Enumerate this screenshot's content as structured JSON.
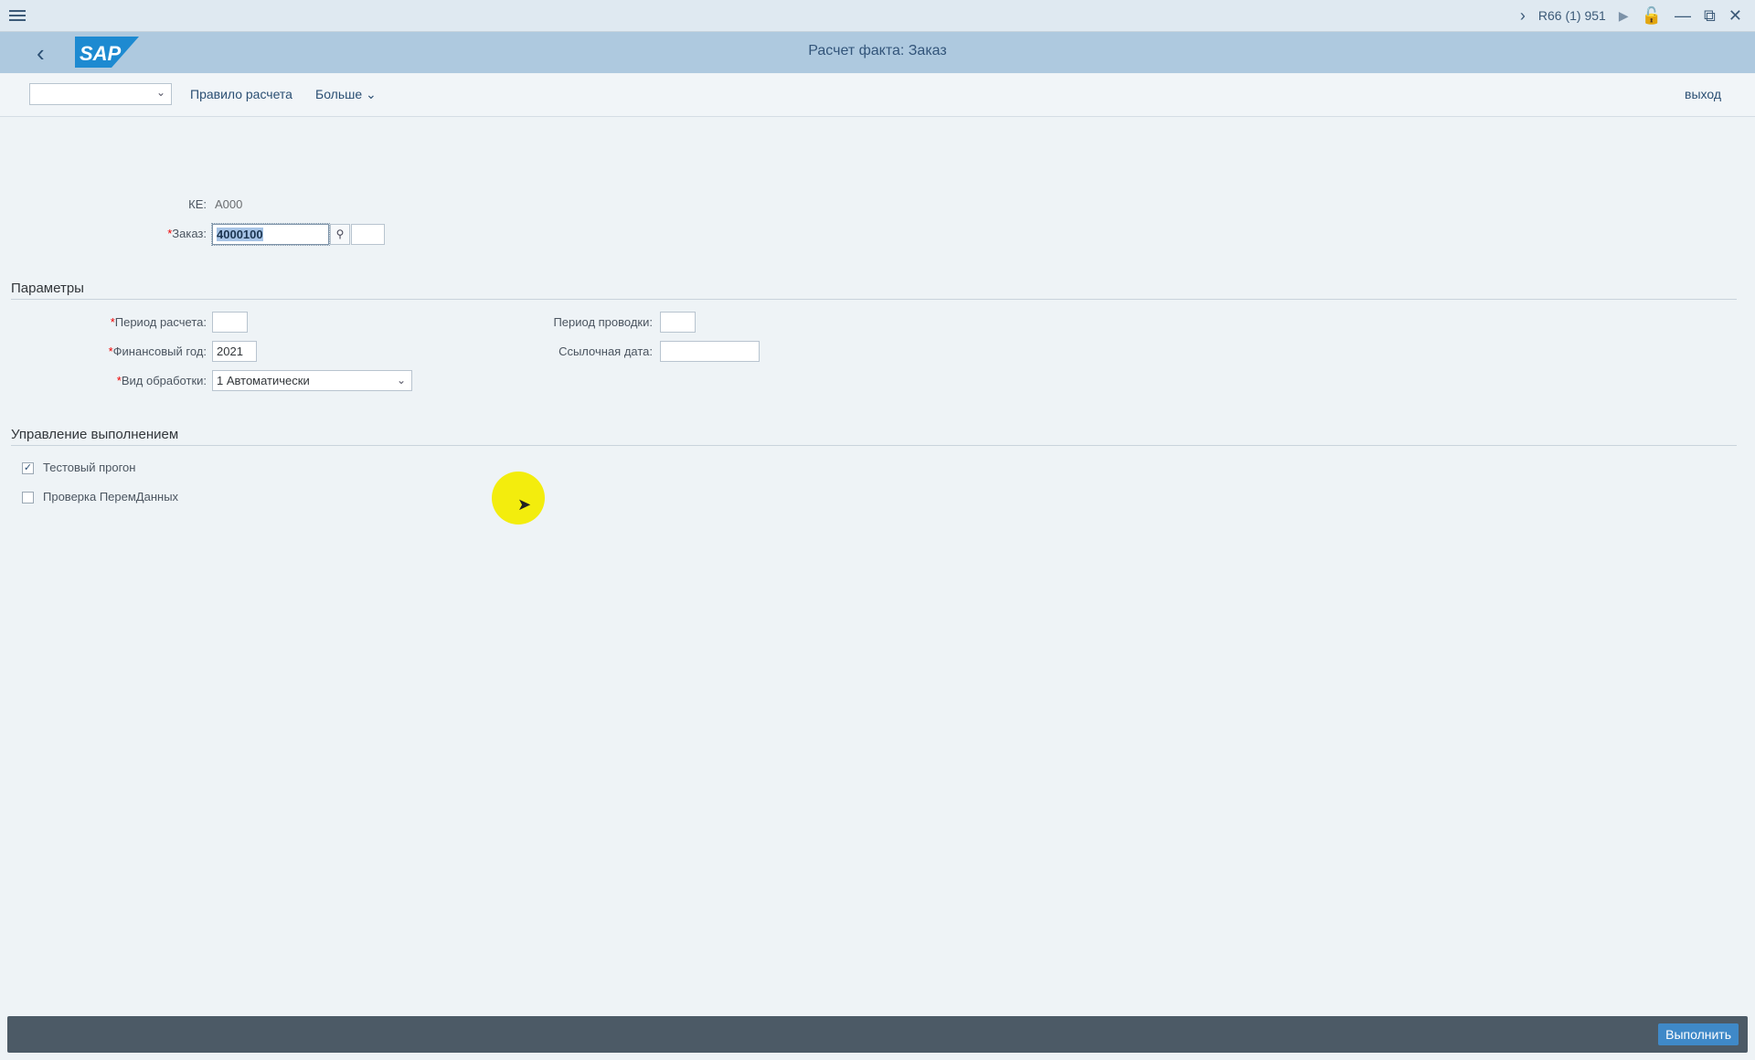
{
  "system": {
    "session": "R66 (1) 951",
    "icons": [
      "menu-icon",
      "chevron-right-icon",
      "play-icon",
      "lock-icon",
      "minimize-icon",
      "maximize-icon",
      "close-icon"
    ]
  },
  "header": {
    "title": "Расчет факта: Заказ",
    "logo": "SAP"
  },
  "toolbar": {
    "variant_value": "",
    "rule_label": "Правило расчета",
    "more_label": "Больше",
    "exit_label": "выход"
  },
  "selection": {
    "ke_label": "КЕ:",
    "ke_value": "A000",
    "order_label": "Заказ:",
    "order_value": "4000100",
    "order_second_value": ""
  },
  "params": {
    "title": "Параметры",
    "period_label": "Период расчета:",
    "period_value": "",
    "fiscal_year_label": "Финансовый год:",
    "fiscal_year_value": "2021",
    "processing_label": "Вид обработки:",
    "processing_value": "1 Автоматически",
    "posting_period_label": "Период проводки:",
    "posting_period_value": "",
    "ref_date_label": "Ссылочная дата:",
    "ref_date_value": ""
  },
  "control": {
    "title": "Управление выполнением",
    "test_run_label": "Тестовый прогон",
    "test_run_checked": true,
    "check_label": "Проверка ПеремДанных",
    "check_checked": false
  },
  "footer": {
    "execute_label": "Выполнить"
  },
  "colors": {
    "header_bg": "#aec9df",
    "accent": "#3f89c8",
    "required": "#ff0000",
    "footer_bg": "#4c5a66"
  }
}
